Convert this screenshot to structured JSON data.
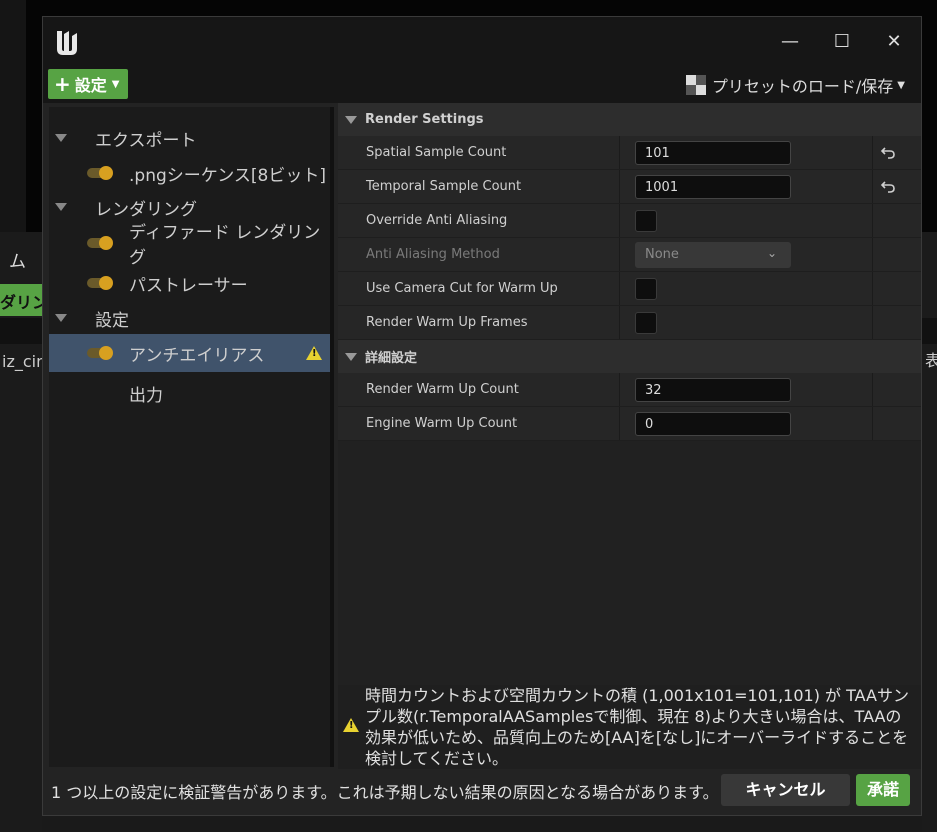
{
  "background": {
    "left_tab": "ムー",
    "left_button": "ダリング",
    "left_text": "iz_cin",
    "right_text": "表"
  },
  "window": {
    "minimize": "—",
    "maximize": "☐",
    "close": "✕"
  },
  "toolbar": {
    "settings_label": "設定",
    "preset_label": "プリセットのロード/保存"
  },
  "tree": {
    "items": [
      {
        "label": "エクスポート",
        "type": "category"
      },
      {
        "label": ".pngシーケンス[8ビット]",
        "type": "setting"
      },
      {
        "label": "レンダリング",
        "type": "category"
      },
      {
        "label": "ディファード レンダリング",
        "type": "setting"
      },
      {
        "label": "パストレーサー",
        "type": "setting"
      },
      {
        "label": "設定",
        "type": "category"
      },
      {
        "label": "アンチエイリアス",
        "type": "setting",
        "selected": true,
        "warning": true
      },
      {
        "label": "出力",
        "type": "setting"
      }
    ]
  },
  "render_settings": {
    "header": "Render Settings",
    "rows": [
      {
        "label": "Spatial Sample Count",
        "value": "101",
        "control": "number",
        "reset": true
      },
      {
        "label": "Temporal Sample Count",
        "value": "1001",
        "control": "number",
        "reset": true
      },
      {
        "label": "Override Anti Aliasing",
        "control": "checkbox",
        "checked": false
      },
      {
        "label": "Anti Aliasing Method",
        "value": "None",
        "control": "dropdown",
        "disabled": true
      },
      {
        "label": "Use Camera Cut for Warm Up",
        "control": "checkbox",
        "checked": false
      },
      {
        "label": "Render Warm Up Frames",
        "control": "checkbox",
        "checked": false
      }
    ]
  },
  "advanced": {
    "header": "詳細設定",
    "rows": [
      {
        "label": "Render Warm Up Count",
        "value": "32",
        "control": "number"
      },
      {
        "label": "Engine Warm Up Count",
        "value": "0",
        "control": "number"
      }
    ]
  },
  "warning_message": "時間カウントおよび空間カウントの積 (1,001x101=101,101) が TAAサンプル数(r.TemporalAASamplesで制御、現在 8)より大きい場合は、TAAの効果が低いため、品質向上のため[AA]を[なし]にオーバーライドすることを検討してください。",
  "footer": {
    "message": "1 つ以上の設定に検証警告があります。これは予期しない結果の原因となる場合があります。",
    "cancel_label": "キャンセル",
    "accept_label": "承諾"
  },
  "colors": {
    "accent_green": "#57a344",
    "selection": "#40536b",
    "toggle_on": "#d8a020",
    "warning": "#e8d230"
  }
}
